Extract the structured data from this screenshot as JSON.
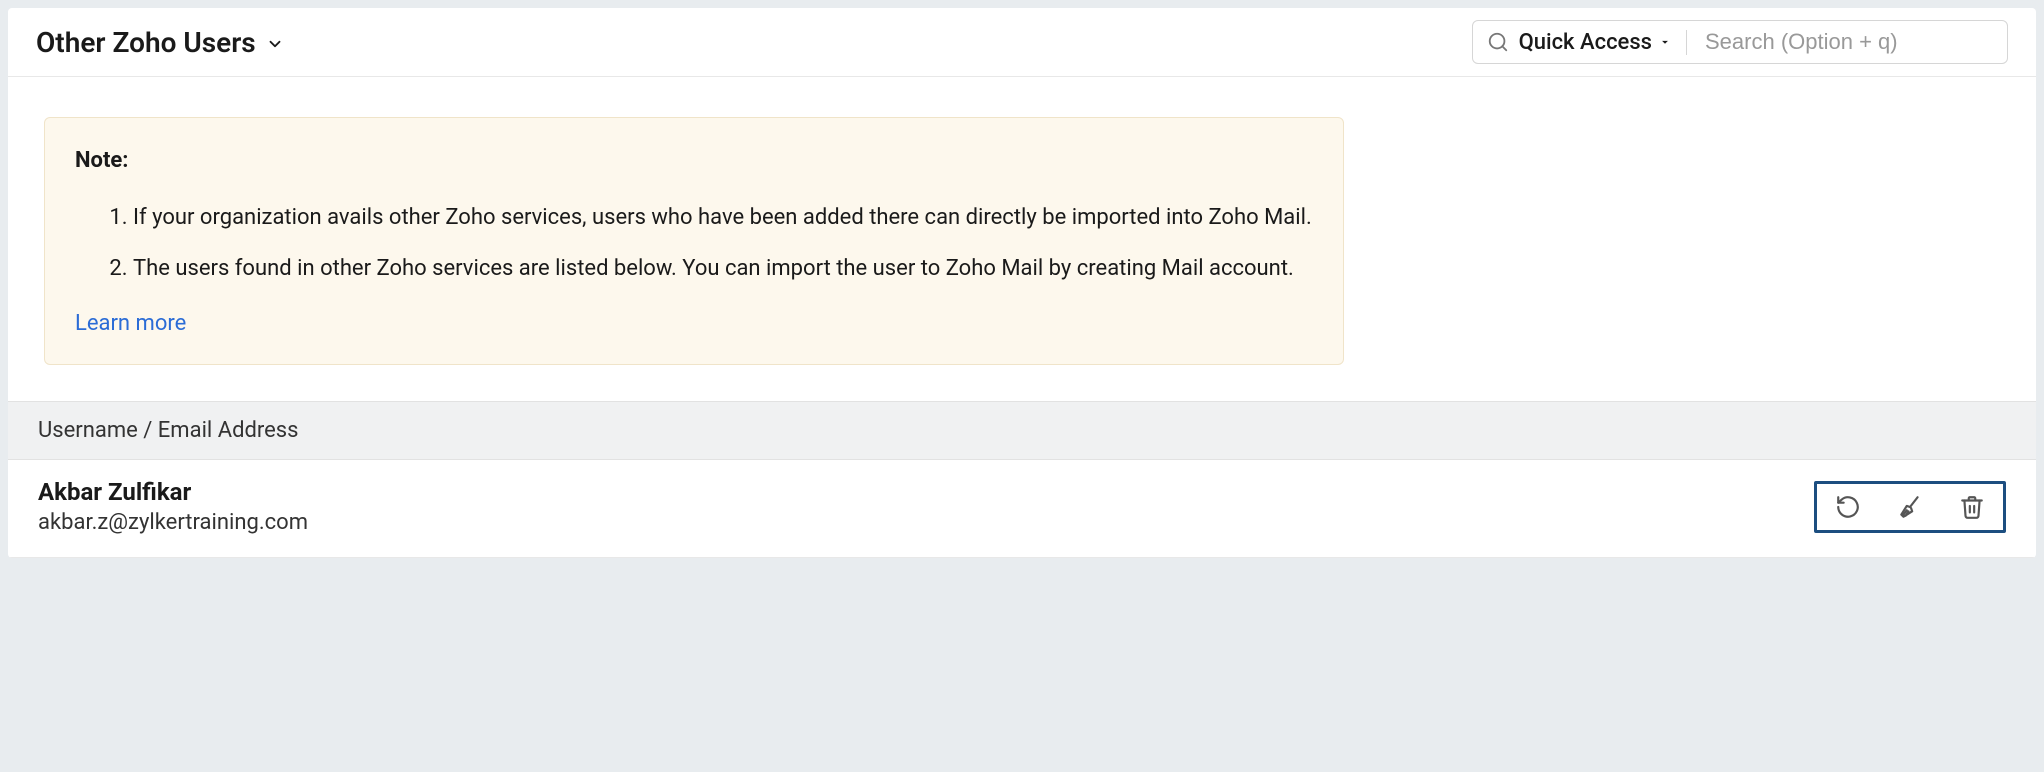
{
  "header": {
    "title": "Other Zoho Users",
    "quick_access_label": "Quick Access",
    "search_placeholder": "Search (Option + q)"
  },
  "note": {
    "label": "Note:",
    "items": [
      "If your organization avails other Zoho services, users who have been added there can directly be imported into Zoho Mail.",
      "The users found in other Zoho services are listed below. You can import the user to Zoho Mail by creating Mail account."
    ],
    "learn_more": "Learn more"
  },
  "table": {
    "header": "Username / Email Address"
  },
  "users": [
    {
      "name": "Akbar Zulfikar",
      "email": "akbar.z@zylkertraining.com"
    }
  ]
}
